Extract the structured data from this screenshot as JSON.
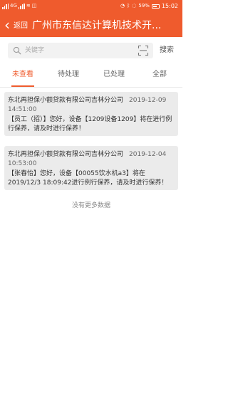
{
  "status_bar": {
    "time": "15:02",
    "battery": "59%",
    "network": "4G"
  },
  "nav": {
    "back_label": "返回",
    "title": "广州市东信达计算机技术开..."
  },
  "search": {
    "placeholder": "关键字",
    "button_label": "搜索"
  },
  "tabs": [
    {
      "label": "未查看",
      "active": true
    },
    {
      "label": "待处理",
      "active": false
    },
    {
      "label": "已处理",
      "active": false
    },
    {
      "label": "全部",
      "active": false
    }
  ],
  "messages": [
    {
      "company": "东北再担保小额贷款有限公司吉林分公司",
      "time": "2019-12-09 14:51:00",
      "body": "【员工（招）】您好，设备【1209设备1209】将在进行例行保养，请及时进行保养！"
    },
    {
      "company": "东北再担保小额贷款有限公司吉林分公司",
      "time": "2019-12-04 10:53:00",
      "body": "【张春怡】您好，设备【00055饮水机a3】将在2019/12/3 18:09:42进行例行保养，请及时进行保养！"
    }
  ],
  "footer": {
    "no_more": "没有更多数据"
  },
  "colors": {
    "accent": "#ef5b2d",
    "card_bg": "#ebebeb"
  }
}
